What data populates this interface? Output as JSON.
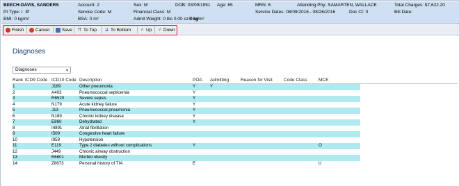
{
  "banner": {
    "name": "BEECH-DAVIS, SANDERS",
    "account_label": "Account:",
    "account_value": "2",
    "sex_label": "Sex:",
    "sex_value": "M",
    "dob_label": "DOB:",
    "dob_value": "03/09/1951",
    "age_label": "Age:",
    "age_value": "65",
    "mrn_label": "MRN:",
    "mrn_value": "6",
    "attending_label": "Attending Phy:",
    "attending_value": "SAMARTEN, WALLACE",
    "total_label": "Total Charges:",
    "total_value": "$7,622.20",
    "pttype_label": "Pt Type:",
    "pttype_value": "I",
    "pttype_extra": "IP",
    "servicecode_label": "Service Code:",
    "servicecode_value": "M",
    "fin_label": "Financial Class:",
    "fin_value": "M",
    "servicedates_label": "Service Dates:",
    "servicedates_value": "08/09/2016 - 08/26/2016",
    "docct_label": "Doc Ct:",
    "docct_value": "0",
    "billdate_label": "Bill Date:",
    "billdate_value": "",
    "bmi_label": "BMI:",
    "bmi_value": "0 kg/m²",
    "bsa_label": "BSA:",
    "bsa_value": "0 m²",
    "admit_label": "Admit Weight:",
    "admit_value": "0 lbs 0.00 oz 0 kg",
    "extra_line": "0 kg/m²"
  },
  "toolbar": {
    "finish": "Finish",
    "cancel": "Cancel",
    "save": "Save",
    "to_top": "To Top",
    "to_bottom": "To Bottom",
    "up": "Up",
    "down": "Down"
  },
  "page": {
    "title": "Diagnoses",
    "select_value": "Diagnoses"
  },
  "table": {
    "headers": [
      "Rank",
      "ICD9 Code",
      "ICD10 Code",
      "Description",
      "POA",
      "Admitting",
      "Reason for Visit",
      "Code Class",
      "MCE"
    ],
    "rows": [
      {
        "rank": "1",
        "icd9": "",
        "icd10": "J189",
        "desc": "Other pneumonia",
        "poa": "Y",
        "adm": "Y",
        "rfv": "",
        "cls": "",
        "mce": "",
        "hl": true
      },
      {
        "rank": "2",
        "icd9": "",
        "icd10": "A403",
        "desc": "Pneumococcal septicemia",
        "poa": "Y",
        "adm": "",
        "rfv": "",
        "cls": "",
        "mce": "",
        "hl": false
      },
      {
        "rank": "3",
        "icd9": "",
        "icd10": "R6520",
        "desc": "Severe sepsis",
        "poa": "Y",
        "adm": "",
        "rfv": "",
        "cls": "",
        "mce": "",
        "hl": true
      },
      {
        "rank": "4",
        "icd9": "",
        "icd10": "N179",
        "desc": "Acute kidney failure",
        "poa": "Y",
        "adm": "",
        "rfv": "",
        "cls": "",
        "mce": "",
        "hl": false
      },
      {
        "rank": "5",
        "icd9": "",
        "icd10": "J13",
        "desc": "Pneumococcal pneumonia",
        "poa": "Y",
        "adm": "",
        "rfv": "",
        "cls": "",
        "mce": "",
        "hl": true
      },
      {
        "rank": "6",
        "icd9": "",
        "icd10": "N189",
        "desc": "Chronic kidney disease",
        "poa": "Y",
        "adm": "",
        "rfv": "",
        "cls": "",
        "mce": "",
        "hl": false
      },
      {
        "rank": "7",
        "icd9": "",
        "icd10": "E860",
        "desc": "Dehydrated",
        "poa": "Y",
        "adm": "",
        "rfv": "",
        "cls": "",
        "mce": "",
        "hl": true
      },
      {
        "rank": "8",
        "icd9": "",
        "icd10": "I4891",
        "desc": "Atrial fibrillation",
        "poa": "",
        "adm": "",
        "rfv": "",
        "cls": "",
        "mce": "",
        "hl": false
      },
      {
        "rank": "9",
        "icd9": "",
        "icd10": "I509",
        "desc": "Congestive heart failure",
        "poa": "",
        "adm": "",
        "rfv": "",
        "cls": "",
        "mce": "",
        "hl": true
      },
      {
        "rank": "10",
        "icd9": "",
        "icd10": "I959",
        "desc": "Hypotension",
        "poa": "",
        "adm": "",
        "rfv": "",
        "cls": "",
        "mce": "",
        "hl": false
      },
      {
        "rank": "11",
        "icd9": "",
        "icd10": "E119",
        "desc": "Type 2 diabetes without complications",
        "poa": "Y",
        "adm": "",
        "rfv": "",
        "cls": "",
        "mce": "O",
        "hl": true
      },
      {
        "rank": "12",
        "icd9": "",
        "icd10": "J449",
        "desc": "Chronic airway obstruction",
        "poa": "",
        "adm": "",
        "rfv": "",
        "cls": "",
        "mce": "",
        "hl": false
      },
      {
        "rank": "13",
        "icd9": "",
        "icd10": "E6601",
        "desc": "Morbid obesity",
        "poa": "",
        "adm": "",
        "rfv": "",
        "cls": "",
        "mce": "",
        "hl": true
      },
      {
        "rank": "14",
        "icd9": "",
        "icd10": "Z8673",
        "desc": "Personal history of TIA",
        "poa": "E",
        "adm": "",
        "rfv": "",
        "cls": "",
        "mce": "U",
        "hl": false
      }
    ]
  },
  "colors": {
    "banner_bg": "#cfe0f3",
    "highlight_row": "#aeeaf0",
    "toolbar_outline": "#d9141b",
    "title_color": "#1b3c6b"
  }
}
